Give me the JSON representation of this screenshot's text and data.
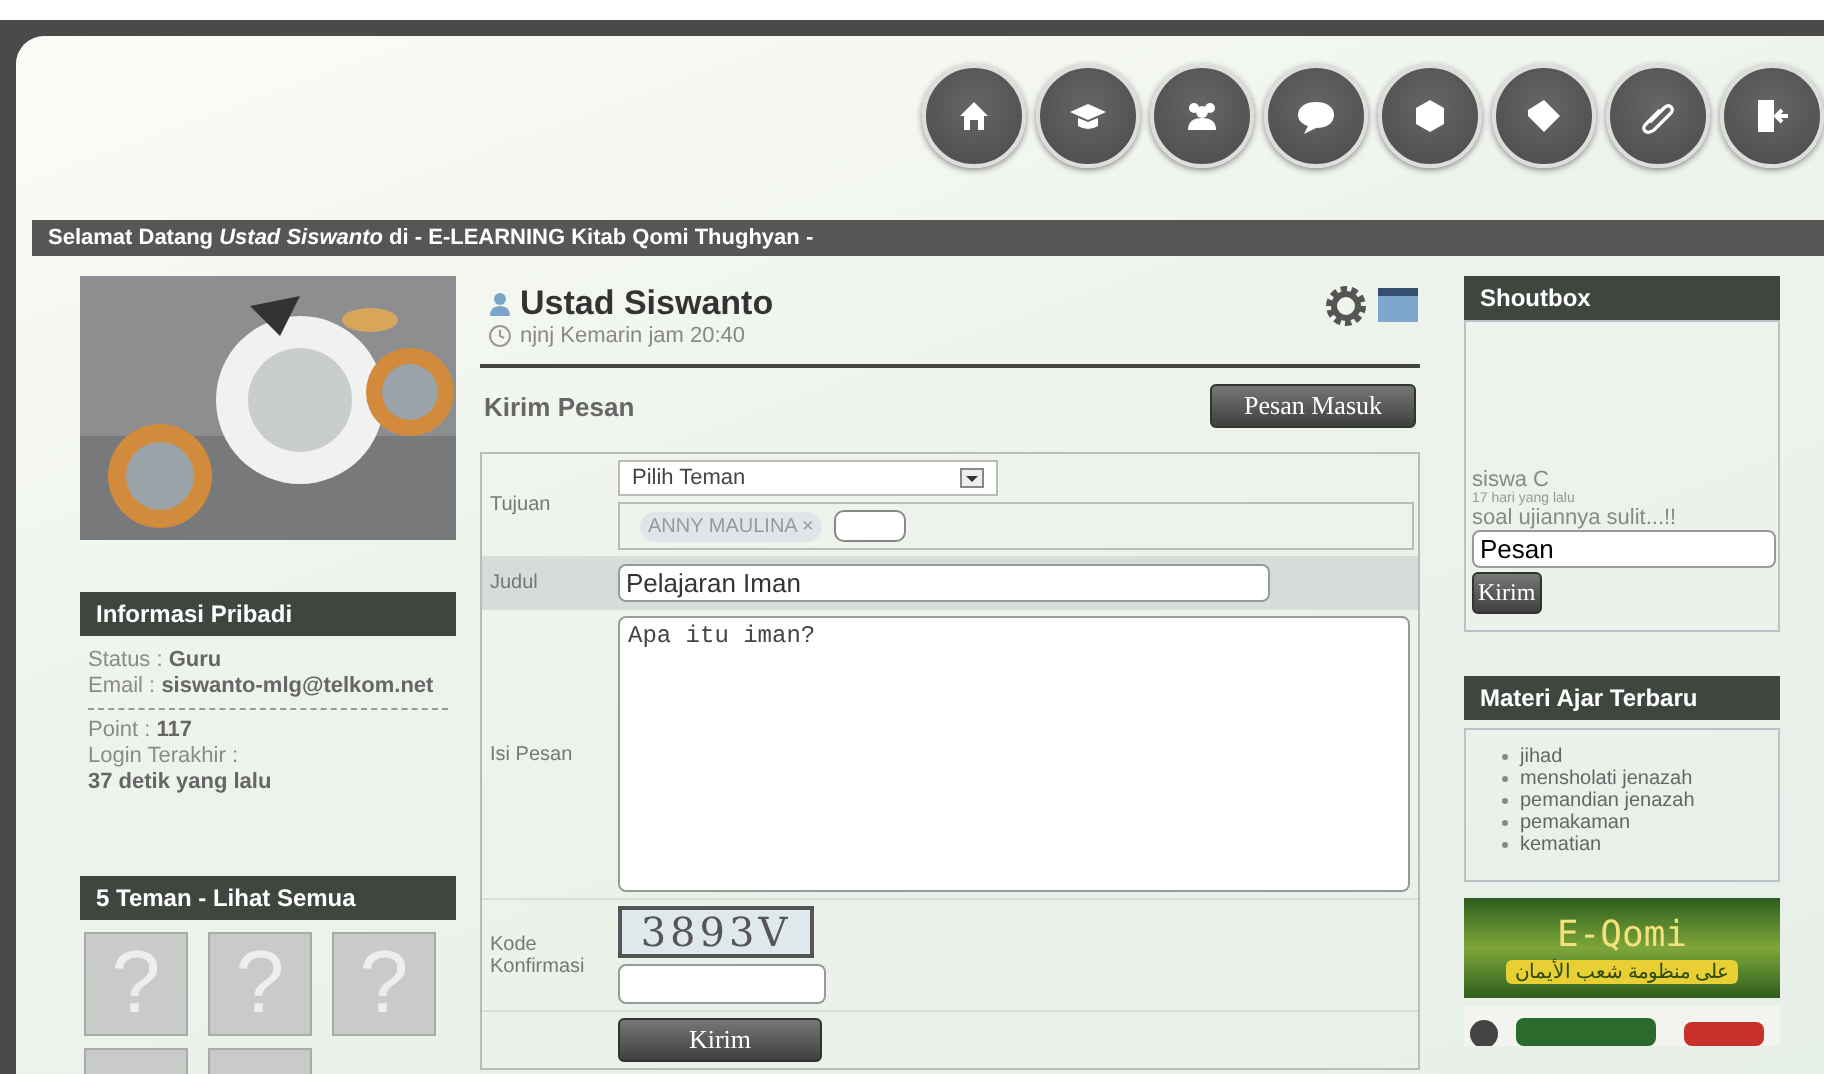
{
  "welcome_bar": {
    "text": "Selamat Datang *Ustad Siswanto* di - E-LEARNING Kitab Qomi Thughyan -"
  },
  "personal_info": {
    "title": "Informasi Pribadi",
    "lines": [
      "Status : **Guru**",
      "Email : **siswanto-mlg@telkom.net**"
    ],
    "lines_2": [
      "Point : **117**",
      "Login Terakhir :",
      "**37 detik yang lalu**"
    ]
  },
  "friends": {
    "title": "5 Teman - Lihat Semua",
    "items": [
      {
        "kind": "avatar",
        "label": "?"
      },
      {
        "kind": "avatar",
        "label": "?"
      },
      {
        "kind": "avatar",
        "label": "?"
      },
      {
        "kind": "avatar"
      },
      {
        "kind": "avatar"
      }
    ]
  },
  "profile": {
    "name": "Ustad Siswanto",
    "status": "njnj Kemarin jam 20:40"
  },
  "message_form": {
    "title": "Kirim Pesan",
    "inbox_button": "Pesan Masuk",
    "recipient_label": "Tujuan",
    "recipient_select": "Pilih Teman",
    "recipient_tag": "ANNY MAULINA ×",
    "subject_label": "Judul",
    "subject_value": "Pelajaran Iman",
    "body_label": "Isi Pesan",
    "body_value": "Apa itu iman?",
    "captcha_label": "Kode Konfirmasi",
    "captcha": "3893V",
    "submit_button": "Kirim"
  },
  "shoutbox": {
    "title": "Shoutbox",
    "author": "siswa C",
    "time": "17 hari yang lalu",
    "message": "soal ujiannya sulit...!!",
    "input_value": "Pesan",
    "send_button": "Kirim"
  },
  "materials": {
    "title": "Materi Ajar Terbaru",
    "items": [
      "jihad",
      "mensholati jenazah",
      "pemandian jenazah",
      "pemakaman",
      "kematian"
    ]
  },
  "banner": {
    "title": "E-Qomi",
    "subtitle": "على منظومة شعب الأيمان"
  }
}
